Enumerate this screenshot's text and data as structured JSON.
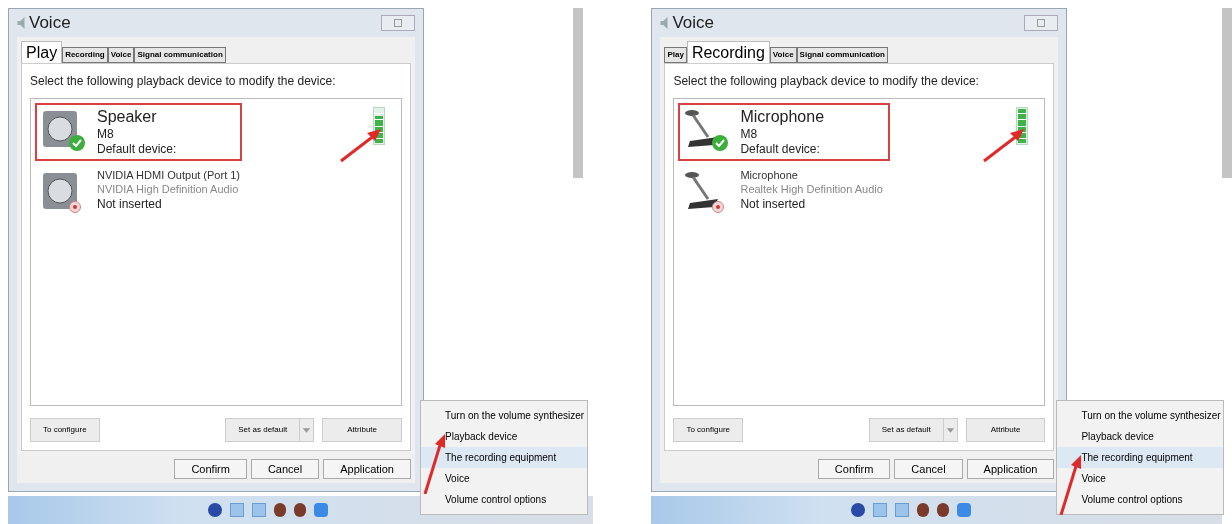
{
  "panels": [
    {
      "window": {
        "title": "Voice"
      },
      "tabs": [
        {
          "label": "Play",
          "selected": true
        },
        {
          "label": "Recording",
          "selected": false
        },
        {
          "label": "Voice",
          "selected": false
        },
        {
          "label": "Signal communication",
          "selected": false
        }
      ],
      "instruction": "Select the following playback device to modify the device:",
      "devices": [
        {
          "kind": "speaker",
          "name": "Speaker",
          "model": "M8",
          "status": "Default device:",
          "default": true,
          "highlighted": true,
          "level": 0.8
        },
        {
          "kind": "speaker",
          "name": "NVIDIA HDMI Output (Port 1)",
          "model": "NVIDIA High Definition Audio",
          "status": "Not inserted",
          "default": false,
          "highlighted": false
        }
      ],
      "buttons": [
        "To configure",
        "Set as default",
        "Attribute"
      ],
      "dialog_buttons": [
        "Confirm",
        "Cancel",
        "Application"
      ],
      "menu": [
        {
          "label": "Turn on the volume synthesizer",
          "selected": false
        },
        {
          "label": "Playback device",
          "selected": false
        },
        {
          "label": "The recording equipment",
          "selected": true
        },
        {
          "label": "Voice",
          "selected": false
        },
        {
          "label": "Volume control options",
          "selected": false
        }
      ]
    },
    {
      "window": {
        "title": "Voice"
      },
      "tabs": [
        {
          "label": "Play",
          "selected": false
        },
        {
          "label": "Recording",
          "selected": true
        },
        {
          "label": "Voice",
          "selected": false
        },
        {
          "label": "Signal communication",
          "selected": false
        }
      ],
      "instruction": "Select the following playback device to modify the device:",
      "devices": [
        {
          "kind": "microphone",
          "name": "Microphone",
          "model": "M8",
          "status": "Default device:",
          "default": true,
          "highlighted": true,
          "level": 1
        },
        {
          "kind": "microphone",
          "name": "Microphone",
          "model": "Realtek High Definition Audio",
          "status": "Not inserted",
          "default": false,
          "highlighted": false
        }
      ],
      "buttons": [
        "To configure",
        "Set as default",
        "Attribute"
      ],
      "dialog_buttons": [
        "Confirm",
        "Cancel",
        "Application"
      ],
      "menu": [
        {
          "label": "Turn on the volume synthesizer",
          "selected": false
        },
        {
          "label": "Playback device",
          "selected": false
        },
        {
          "label": "The recording equipment",
          "selected": true
        },
        {
          "label": "Voice",
          "selected": false
        },
        {
          "label": "Volume control options",
          "selected": false
        }
      ]
    }
  ]
}
